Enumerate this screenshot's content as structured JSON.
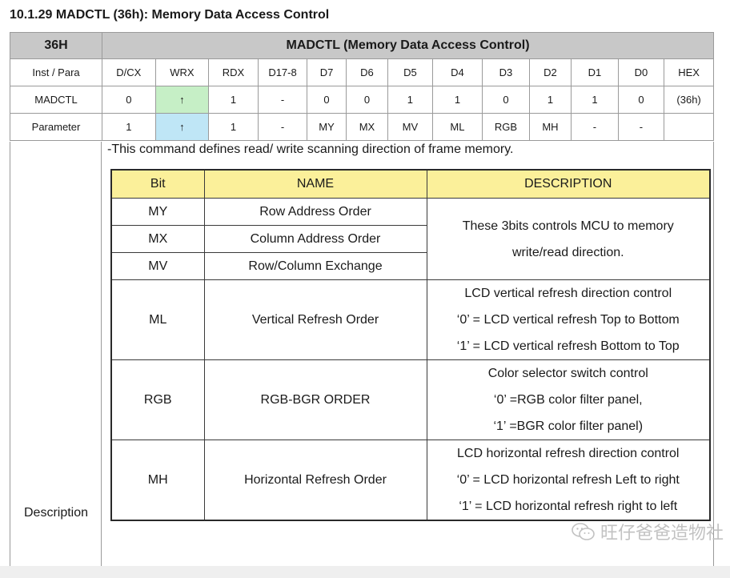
{
  "heading": "10.1.29 MADCTL (36h): Memory Data Access Control",
  "register": {
    "header": {
      "code": "36H",
      "title": "MADCTL (Memory Data Access Control)"
    },
    "columns": [
      "Inst / Para",
      "D/CX",
      "WRX",
      "RDX",
      "D17-8",
      "D7",
      "D6",
      "D5",
      "D4",
      "D3",
      "D2",
      "D1",
      "D0",
      "HEX"
    ],
    "rows": [
      {
        "cells": [
          "MADCTL",
          "0",
          "↑",
          "1",
          "-",
          "0",
          "0",
          "1",
          "1",
          "0",
          "1",
          "1",
          "0",
          "(36h)"
        ]
      },
      {
        "cells": [
          "Parameter",
          "1",
          "↑",
          "1",
          "-",
          "MY",
          "MX",
          "MV",
          "ML",
          "RGB",
          "MH",
          "-",
          "-",
          ""
        ]
      }
    ],
    "wrx_colors": [
      "#c6efc6",
      "#bfe6f6"
    ]
  },
  "description_label": "Description",
  "intro": "-This command defines read/ write scanning direction of frame memory.",
  "bit_table": {
    "headers": [
      "Bit",
      "NAME",
      "DESCRIPTION"
    ],
    "header_color": "#fbf09a",
    "rows": [
      {
        "bit": "MY",
        "name": "Row Address Order"
      },
      {
        "bit": "MX",
        "name": "Column Address Order"
      },
      {
        "bit": "MV",
        "name": "Row/Column Exchange"
      },
      {
        "bit": "ML",
        "name": "Vertical Refresh Order"
      },
      {
        "bit": "RGB",
        "name": "RGB-BGR ORDER"
      },
      {
        "bit": "MH",
        "name": "Horizontal Refresh Order"
      }
    ],
    "descriptions": {
      "mcu": [
        "These 3bits controls MCU to memory",
        "write/read direction."
      ],
      "ml": [
        "LCD vertical refresh direction control",
        "‘0’ = LCD vertical refresh Top to Bottom",
        "‘1’ = LCD vertical refresh Bottom to Top"
      ],
      "rgb": [
        "Color selector switch control",
        "‘0’ =RGB color filter panel,",
        "‘1’ =BGR color filter panel)"
      ],
      "mh": [
        "LCD horizontal refresh direction control",
        "‘0’ = LCD horizontal refresh Left to right",
        "‘1’ = LCD horizontal refresh right to left"
      ]
    }
  },
  "watermark": {
    "text": "旺仔爸爸造物社",
    "icon": "wechat-icon"
  }
}
